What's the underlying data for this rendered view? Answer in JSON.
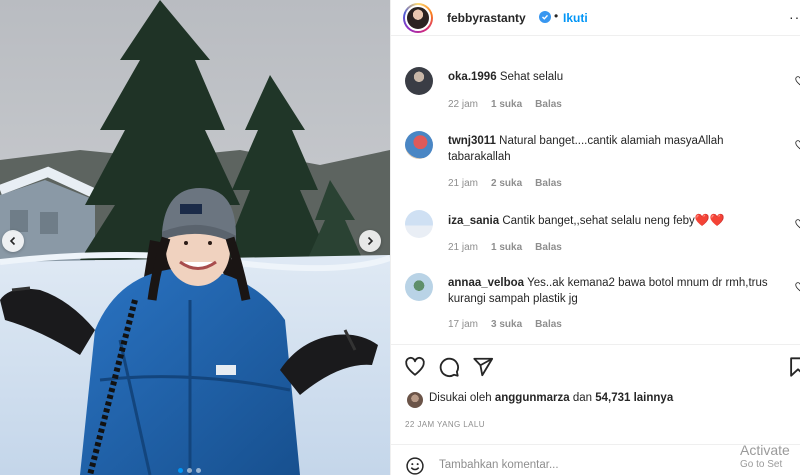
{
  "post": {
    "image_alt": "Woman in blue puffer jacket and beanie in a snowy landscape with pine trees",
    "carousel": {
      "dot_count": 3,
      "active_index": 0
    }
  },
  "header": {
    "username": "febbyrastanty",
    "separator": "•",
    "follow_label": "Ikuti",
    "more_label": "···"
  },
  "comments": [
    {
      "username": "oka.1996",
      "text": "Sehat selalu",
      "time": "22 jam",
      "likes": "1 suka",
      "reply": "Balas"
    },
    {
      "username": "twnj3011",
      "text": "Natural banget....cantik alamiah masyaAllah tabarakallah",
      "time": "21 jam",
      "likes": "2 suka",
      "reply": "Balas"
    },
    {
      "username": "iza_sania",
      "text": "Cantik banget,,sehat selalu neng feby",
      "emoji": "❤️❤️",
      "time": "21 jam",
      "likes": "1 suka",
      "reply": "Balas"
    },
    {
      "username": "annaa_velboa",
      "text": "Yes..ak kemana2 bawa botol mnum dr rmh,trus kurangi sampah plastik jg",
      "time": "17 jam",
      "likes": "3 suka",
      "reply": "Balas"
    }
  ],
  "likes": {
    "prefix": "Disukai oleh",
    "user": "anggunmarza",
    "middle": "dan",
    "count": "54,731 lainnya"
  },
  "timestamp": "22 JAM YANG LALU",
  "add_comment": {
    "placeholder": "Tambahkan komentar..."
  },
  "watermark": {
    "line1": "Activate",
    "line2": "Go to Set"
  },
  "colors": {
    "link": "#0095f6",
    "verified": "#3897f0",
    "heart": "#e0245e",
    "jacket": "#1f5fa6"
  },
  "icons": [
    "chevron-left-icon",
    "chevron-right-icon",
    "verified-icon",
    "heart-icon",
    "comment-icon",
    "share-icon",
    "bookmark-icon",
    "emoji-icon"
  ]
}
